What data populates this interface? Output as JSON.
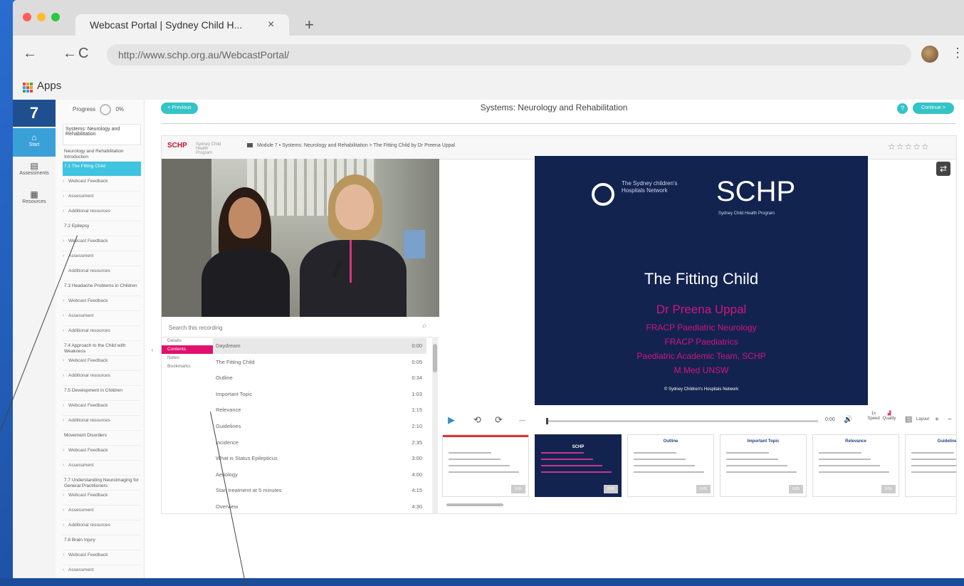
{
  "browser": {
    "tab_title": "Webcast Portal | Sydney Child H...",
    "tab_close": "×",
    "new_tab": "+",
    "url": "http://www.schp.org.au/WebcastPortal/",
    "bookmarks_label": "Apps",
    "traffic_colors": [
      "#ff5f57",
      "#febc2e",
      "#28c840"
    ]
  },
  "rail": {
    "module_number": "7",
    "items": [
      {
        "label": "Start",
        "icon": "home-icon"
      },
      {
        "label": "Assessments",
        "icon": "document-icon"
      },
      {
        "label": "Resources",
        "icon": "folder-icon"
      }
    ]
  },
  "toc": {
    "progress_label": "Progress",
    "progress_value": "0%",
    "heading": "Systems: Neurology and Rehabilitation",
    "items": [
      {
        "text": "Neurology and Rehabilitation Introduction",
        "kind": "sec",
        "state": ""
      },
      {
        "text": "7.1 The Fitting Child",
        "kind": "sec",
        "state": "active"
      },
      {
        "text": "Webcast Feedback",
        "kind": "sub",
        "state": ""
      },
      {
        "text": "Assessment",
        "kind": "sub",
        "state": ""
      },
      {
        "text": "Additional resources",
        "kind": "sub",
        "state": ""
      },
      {
        "text": "7.2 Epilepsy",
        "kind": "sec",
        "state": ""
      },
      {
        "text": "Webcast Feedback",
        "kind": "sub",
        "state": ""
      },
      {
        "text": "Assessment",
        "kind": "sub",
        "state": ""
      },
      {
        "text": "Additional resources",
        "kind": "sub",
        "state": ""
      },
      {
        "text": "7.3 Headache Problems in Children",
        "kind": "sec",
        "state": ""
      },
      {
        "text": "Webcast Feedback",
        "kind": "sub",
        "state": ""
      },
      {
        "text": "Assessment",
        "kind": "sub",
        "state": ""
      },
      {
        "text": "Additional resources",
        "kind": "sub",
        "state": ""
      },
      {
        "text": "7.4 Approach to the Child with Weakness",
        "kind": "sec",
        "state": ""
      },
      {
        "text": "Webcast Feedback",
        "kind": "sub",
        "state": ""
      },
      {
        "text": "Additional resources",
        "kind": "sub",
        "state": ""
      },
      {
        "text": "7.5 Development in Children",
        "kind": "sec",
        "state": ""
      },
      {
        "text": "Webcast Feedback",
        "kind": "sub",
        "state": ""
      },
      {
        "text": "Additional resources",
        "kind": "sub",
        "state": ""
      },
      {
        "text": "Movement Disorders",
        "kind": "sec",
        "state": ""
      },
      {
        "text": "Webcast Feedback",
        "kind": "sub",
        "state": ""
      },
      {
        "text": "Assessment",
        "kind": "sub",
        "state": ""
      },
      {
        "text": "7.7 Understanding Neuroimaging for General Practitioners",
        "kind": "sec",
        "state": ""
      },
      {
        "text": "Webcast Feedback",
        "kind": "sub",
        "state": ""
      },
      {
        "text": "Assessment",
        "kind": "sub",
        "state": ""
      },
      {
        "text": "Additional resources",
        "kind": "sub",
        "state": ""
      },
      {
        "text": "7.8 Brain Injury",
        "kind": "sec",
        "state": ""
      },
      {
        "text": "Webcast Feedback",
        "kind": "sub",
        "state": ""
      },
      {
        "text": "Assessment",
        "kind": "sub",
        "state": ""
      }
    ]
  },
  "main": {
    "prev_label": "< Previous",
    "title": "Systems: Neurology and Rehabilitation",
    "help_glyph": "?",
    "next_label": "Continue >"
  },
  "player": {
    "logo": "SCHP",
    "logo_sub": "Sydney Child Health Program",
    "breadcrumb": "Module 7 • Systems: Neurology and Rehabilitation  >  The Fitting Child by Dr Preena Uppal",
    "rating": "☆☆☆☆☆",
    "search_placeholder": "Search this recording",
    "subtabs": [
      {
        "label": "Details",
        "active": false
      },
      {
        "label": "Contents",
        "active": true
      },
      {
        "label": "Notes",
        "active": false
      },
      {
        "label": "Bookmarks",
        "active": false
      }
    ],
    "chapters": [
      {
        "name": "Daydream",
        "time": "0:00",
        "sel": true
      },
      {
        "name": "The Fitting Child",
        "time": "0:05",
        "sel": false
      },
      {
        "name": "Outline",
        "time": "0:34",
        "sel": false
      },
      {
        "name": "Important Topic",
        "time": "1:03",
        "sel": false
      },
      {
        "name": "Relevance",
        "time": "1:15",
        "sel": false
      },
      {
        "name": "Guidelines",
        "time": "2:10",
        "sel": false
      },
      {
        "name": "Incidence",
        "time": "2:35",
        "sel": false
      },
      {
        "name": "What is Status Epilepticus",
        "time": "3:00",
        "sel": false
      },
      {
        "name": "Aetiology",
        "time": "4:00",
        "sel": false
      },
      {
        "name": "Start treatment at 5 minutes",
        "time": "4:15",
        "sel": false
      },
      {
        "name": "Overview",
        "time": "4:30",
        "sel": false
      }
    ],
    "slide": {
      "org": "The Sydney children's Hospitals Network",
      "brand": "SCHP",
      "brand_sub": "Sydney Child Health Program",
      "title": "The Fitting Child",
      "author": "Dr Preena Uppal",
      "cred1": "FRACP Paediatric Neurology",
      "cred2": "FRACP Paediatrics",
      "cred3": "Paediatric Academic Team, SCHP",
      "cred4": "M.Med UNSW",
      "copyright": "© Sydney Children's Hospitals Network",
      "accent": "#d1157e",
      "background": "#132350"
    },
    "controls": {
      "play": "▶",
      "rewind": "⟲",
      "forward": "⟳",
      "time_readout": "0:00",
      "volume": "🔊",
      "speed_value": "1x",
      "speed_label": "Speed",
      "zoom_label": "Quality",
      "layout_label": "Layout",
      "plus": "+",
      "minus": "−"
    },
    "thumbnails": [
      {
        "title": "",
        "dark": false
      },
      {
        "title": "SCHP",
        "dark": true
      },
      {
        "title": "Outline",
        "dark": false
      },
      {
        "title": "Important Topic",
        "dark": false
      },
      {
        "title": "Relevance",
        "dark": false
      },
      {
        "title": "Guidelines",
        "dark": false
      }
    ],
    "thumb_duration": "0:05"
  },
  "colors": {
    "teal": "#34c3c7",
    "magenta": "#e0106e",
    "navy": "#1f4f8f",
    "active_toc": "#3ec3e0"
  }
}
